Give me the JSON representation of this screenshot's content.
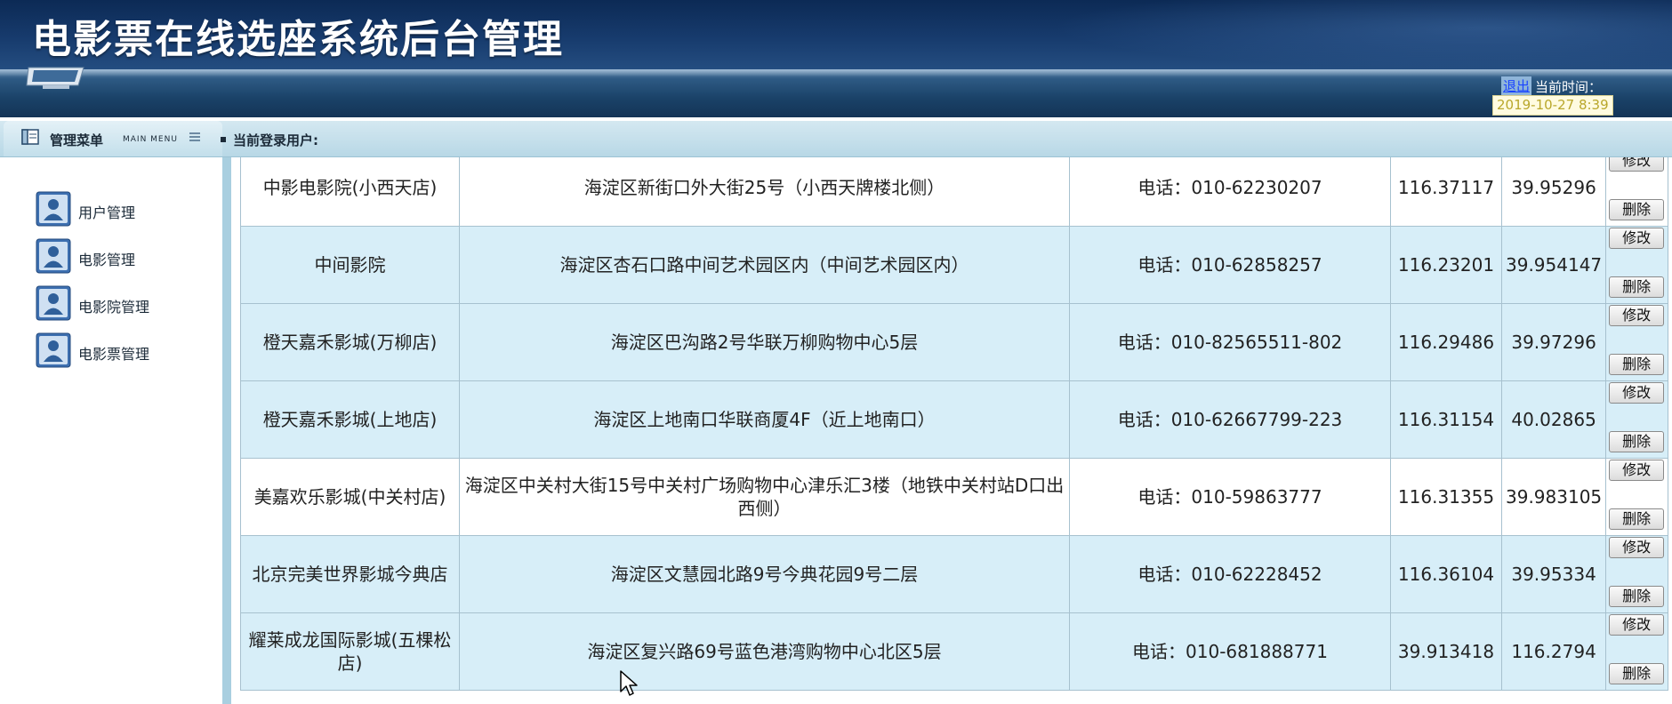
{
  "header": {
    "title": "电影票在线选座系统后台管理",
    "logout_label": "退出",
    "time_label": "当前时间：",
    "time_value": "2019-10-27 8:39"
  },
  "menu": {
    "title": "管理菜单",
    "subtitle": "MAIN MENU",
    "current_user_label": "当前登录用户:"
  },
  "sidebar": {
    "items": [
      {
        "label": "用户管理"
      },
      {
        "label": "电影管理"
      },
      {
        "label": "电影院管理"
      },
      {
        "label": "电影票管理"
      }
    ]
  },
  "table": {
    "edit_label": "修改",
    "delete_label": "删除",
    "rows": [
      {
        "name": "中影电影院(小西天店)",
        "address": "海淀区新街口外大街25号（小西天牌楼北侧）",
        "phone": "电话：010-62230207",
        "lng": "116.37117",
        "lat": "39.95296"
      },
      {
        "name": "中间影院",
        "address": "海淀区杏石口路中间艺术园区内（中间艺术园区内）",
        "phone": "电话：010-62858257",
        "lng": "116.23201",
        "lat": "39.954147"
      },
      {
        "name": "橙天嘉禾影城(万柳店)",
        "address": "海淀区巴沟路2号华联万柳购物中心5层",
        "phone": "电话：010-82565511-802",
        "lng": "116.29486",
        "lat": "39.97296"
      },
      {
        "name": "橙天嘉禾影城(上地店)",
        "address": "海淀区上地南口华联商厦4F（近上地南口）",
        "phone": "电话：010-62667799-223",
        "lng": "116.31154",
        "lat": "40.02865"
      },
      {
        "name": "美嘉欢乐影城(中关村店)",
        "address": "海淀区中关村大街15号中关村广场购物中心津乐汇3楼（地铁中关村站D口出西侧）",
        "phone": "电话：010-59863777",
        "lng": "116.31355",
        "lat": "39.983105"
      },
      {
        "name": "北京完美世界影城今典店",
        "address": "海淀区文慧园北路9号今典花园9号二层",
        "phone": "电话：010-62228452",
        "lng": "116.36104",
        "lat": "39.95334"
      },
      {
        "name": "耀莱成龙国际影城(五棵松店)",
        "address": "海淀区复兴路69号蓝色港湾购物中心北区5层",
        "phone": "电话：010-681888771",
        "lng": "39.913418",
        "lat": "116.2794"
      }
    ]
  },
  "icons": {
    "menu_icon": "menu-window-icon",
    "list_icon": "list-lines-icon",
    "sidebar_icon": "user-shield-icon",
    "cursor": "mouse-pointer-icon"
  },
  "colors": {
    "header_dark": "#0c2a55",
    "row_alt": "#d7eef8",
    "link": "#1a44ff",
    "time_text": "#b9a72b"
  }
}
